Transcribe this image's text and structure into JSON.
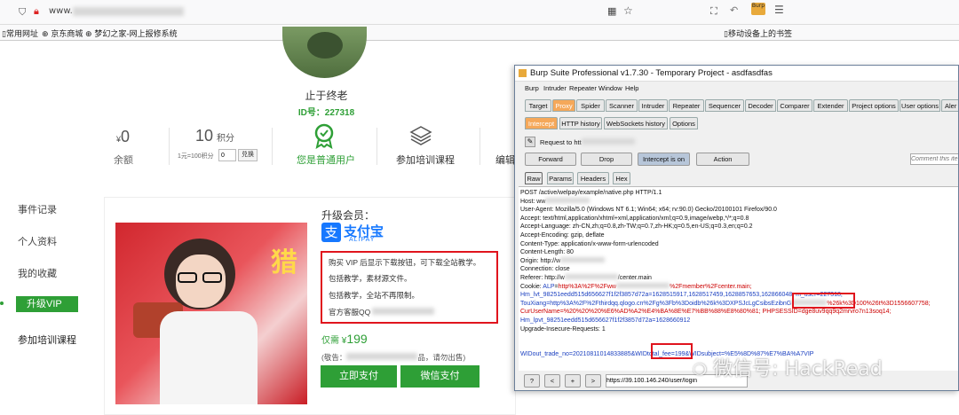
{
  "browser": {
    "url_prefix": "www.",
    "burp_badge": "Burp",
    "bookmarks": [
      "常用网址",
      "京东商城",
      "梦幻之家-网上报修系统"
    ],
    "mobile_bookmarks": "移动设备上的书签"
  },
  "profile": {
    "username": "止于终老",
    "id_label": "ID号：227318",
    "balance_value": "0",
    "balance_prefix": "¥",
    "balance_label": "余额",
    "points_value": "10",
    "points_unit": "积分",
    "exchange_rate": "1元=100积分",
    "exchange_input": "0",
    "exchange_button": "兑换",
    "member_status": "您是普通用户",
    "training_label": "参加培训课程",
    "edit_label": "编辑"
  },
  "sidebar": {
    "items": [
      "事件记录",
      "个人资料",
      "我的收藏",
      "升级VIP",
      "参加培训课程"
    ]
  },
  "vip": {
    "heading": "升级会员：",
    "alipay_cn": "支付宝",
    "alipay_en": "ALIPAY",
    "desc_lines": [
      "购买 VIP 后显示下载按钮，可下载全站教学。",
      "包括教学，素材源文件。",
      "包括教学，全站不再限制。",
      "官方客服QQ"
    ],
    "price_prefix": "仅需 ¥",
    "price": "199",
    "note_prefix": "(敬告：",
    "note_suffix": "品，请勿出售)",
    "pay_button": "立即支付",
    "wechat_button": "微信支付"
  },
  "burp": {
    "title": "Burp Suite Professional v1.7.30 - Temporary Project - asdfasdfas",
    "menu": [
      "Burp",
      "Intruder",
      "Repeater",
      "Window",
      "Help"
    ],
    "tabs": [
      "Target",
      "Proxy",
      "Spider",
      "Scanner",
      "Intruder",
      "Repeater",
      "Sequencer",
      "Decoder",
      "Comparer",
      "Extender",
      "Project options",
      "User options",
      "Aler"
    ],
    "subtabs": [
      "Intercept",
      "HTTP history",
      "WebSockets history",
      "Options"
    ],
    "request_to": "Request to htt",
    "buttons": {
      "forward": "Forward",
      "drop": "Drop",
      "intercept": "Intercept is on",
      "action": "Action"
    },
    "comment_placeholder": "Comment this ite",
    "view_tabs": [
      "Raw",
      "Params",
      "Headers",
      "Hex"
    ],
    "request_lines": [
      "POST /active/welpay/example/native.php HTTP/1.1",
      "Host: ww",
      "User-Agent: Mozilla/5.0 (Windows NT 6.1; Win64; x64; rv:90.0) Gecko/20100101 Firefox/90.0",
      "Accept: text/html,application/xhtml+xml,application/xml;q=0.9,image/webp,*/*;q=0.8",
      "Accept-Language: zh-CN,zh;q=0.8,zh-TW;q=0.7,zh-HK;q=0.5,en-US;q=0.3,en;q=0.2",
      "Accept-Encoding: gzip, deflate",
      "Content-Type: application/x-www-form-urlencoded",
      "Content-Length: 80",
      "Origin: http://w",
      "Connection: close",
      "Referer: http://w",
      "Cookie: ALP=http%3A%2F%2Fww",
      "Hm_lvt_98251eedd515d656627f1f2f3857d72a=1628515917,1628517459,1628857653,162866048",
      "TouXiang=http%3A%2F%2Fthirdqq.qlogo.cn%2Fg%3Fb%3Doidb%26k%3DXPSJcLgCsibsEzibnG",
      "CurUserName=%20%20%20%E6%AD%A2%E4%BA%8E%E7%BB%88%E8%80%81; PHPSESSID=dge8uv9qq9q2mrvro7n13soq14;",
      "Hm_lpvt_98251eedd515d656627f1f2f3857d72a=1628660912",
      "Upgrade-Insecure-Requests: 1",
      "",
      "WIDout_trade_no=20210811014833885&WIDtotal_fee=199&WIDsubject=%E5%8D%87%E7%BA%A7VIP"
    ],
    "referer_tail": "/center.main",
    "cookie_tail": "%2Fmember%2Fcenter.main;",
    "m_user": "m_user=227318;",
    "touxiang_tail": "%26k%3D100%26t%3D1556607758;",
    "bottom_url": "https://39.100.146.240/user/login",
    "bottom_buttons": [
      "?",
      "<",
      "+",
      ">"
    ]
  },
  "watermark": "微信号: HackRead"
}
